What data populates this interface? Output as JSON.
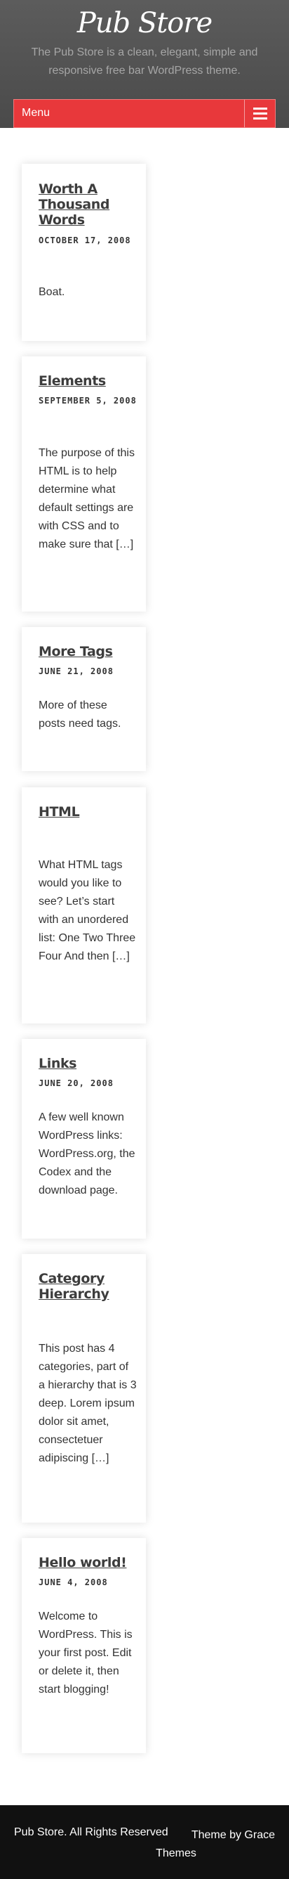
{
  "header": {
    "site_title": "Pub Store",
    "tagline": "The Pub Store is a clean, elegant, simple and responsive free bar WordPress theme."
  },
  "menu": {
    "label": "Menu",
    "toggle_icon": "hamburger-icon"
  },
  "posts": [
    {
      "title": "Worth A Thousand Words",
      "date": "OCTOBER 17, 2008",
      "excerpt": "Boat."
    },
    {
      "title": "Elements",
      "date": "SEPTEMBER 5, 2008",
      "excerpt": "The purpose of this HTML is to help determine what default settings are with CSS and to make sure that […]"
    },
    {
      "title": "More Tags",
      "date": "JUNE 21, 2008",
      "excerpt": "More of these posts need tags."
    },
    {
      "title": "HTML",
      "date": "",
      "excerpt": "What HTML tags would you like to see? Let’s start with an unordered list: One Two Three Four And then […]"
    },
    {
      "title": "Links",
      "date": "JUNE 20, 2008",
      "excerpt": "A few well known WordPress links: WordPress.org, the Codex and the download page."
    },
    {
      "title": "Category Hierarchy",
      "date": "",
      "excerpt": "This post has 4 categories, part of a hierarchy that is 3 deep. Lorem ipsum dolor sit amet, consectetuer adipiscing […]"
    },
    {
      "title": "Hello world!",
      "date": "JUNE 4, 2008",
      "excerpt": "Welcome to WordPress. This is your first post. Edit or delete it, then start blogging!"
    }
  ],
  "footer": {
    "copyright": "Pub Store. All Rights Reserved",
    "theme_by_1": "Theme by Grace",
    "theme_by_2": "Themes"
  },
  "colors": {
    "header_bg": "#4f4f4f",
    "menu_bg": "#e8383b",
    "footer_bg": "#111111"
  }
}
